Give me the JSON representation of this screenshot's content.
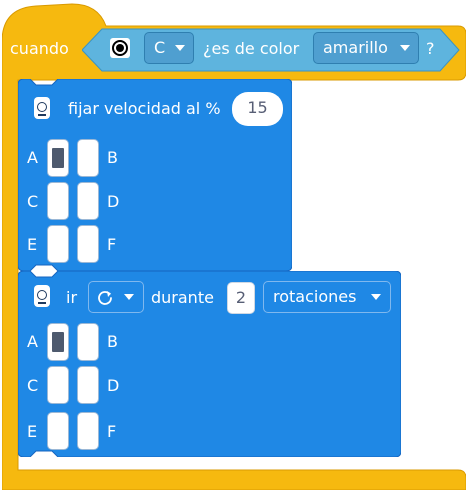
{
  "event": {
    "label": "cuando",
    "port_value": "C",
    "question_label": "¿es de color",
    "color_value": "amarillo",
    "question_end": "?",
    "sensor_icon": "color-sensor-icon"
  },
  "speed_block": {
    "label": "fijar velocidad al %",
    "value": "15",
    "motor_icon": "motor-icon",
    "ports": [
      {
        "letter": "A",
        "selected": true
      },
      {
        "letter": "B",
        "selected": false
      },
      {
        "letter": "C",
        "selected": false
      },
      {
        "letter": "D",
        "selected": false
      },
      {
        "letter": "E",
        "selected": false
      },
      {
        "letter": "F",
        "selected": false
      }
    ]
  },
  "run_block": {
    "label_go": "ir",
    "direction_icon": "clockwise-icon",
    "label_for": "durante",
    "amount": "2",
    "unit": "rotaciones",
    "motor_icon": "motor-icon",
    "ports": [
      {
        "letter": "A",
        "selected": true
      },
      {
        "letter": "B",
        "selected": false
      },
      {
        "letter": "C",
        "selected": false
      },
      {
        "letter": "D",
        "selected": false
      },
      {
        "letter": "E",
        "selected": false
      },
      {
        "letter": "F",
        "selected": false
      }
    ]
  },
  "colors": {
    "event_yellow": "#f6b90f",
    "sensor_light_blue": "#5eb4de",
    "motor_blue": "#1f88e5"
  }
}
